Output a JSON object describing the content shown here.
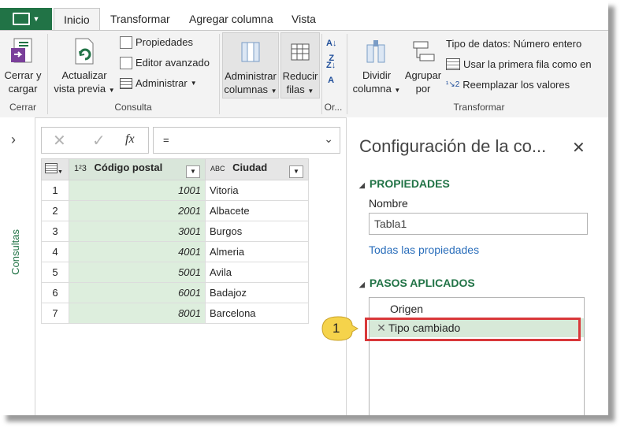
{
  "tabs": {
    "file_label": "",
    "items": [
      "Inicio",
      "Transformar",
      "Agregar columna",
      "Vista"
    ],
    "active": "Inicio"
  },
  "ribbon": {
    "cerrar_y_cargar": [
      "Cerrar y",
      "cargar"
    ],
    "grupo_cerrar": "Cerrar",
    "actualizar": [
      "Actualizar",
      "vista previa"
    ],
    "propiedades": "Propiedades",
    "editor_avanzado": "Editor avanzado",
    "administrar": "Administrar",
    "grupo_consulta": "Consulta",
    "administrar_columnas": [
      "Administrar",
      "columnas"
    ],
    "reducir_filas": [
      "Reducir",
      "filas"
    ],
    "grupo_or": "Or...",
    "dividir_columna": [
      "Dividir",
      "columna"
    ],
    "agrupar_por": [
      "Agrupar",
      "por"
    ],
    "tipo_datos": "Tipo de datos: Número entero",
    "primera_fila": "Usar la primera fila como en",
    "reemplazar": "Reemplazar los valores",
    "grupo_transformar": "Transformar"
  },
  "left_pane": {
    "label": "Consultas"
  },
  "formula_bar": {
    "cancel": "✕",
    "confirm": "✓",
    "fx": "fx",
    "value": "="
  },
  "table": {
    "headers": [
      "Código postal",
      "Ciudad"
    ],
    "header_types": [
      "1²3",
      "ABC"
    ],
    "rows": [
      {
        "n": "1",
        "cp": "1001",
        "city": "Vitoria"
      },
      {
        "n": "2",
        "cp": "2001",
        "city": "Albacete"
      },
      {
        "n": "3",
        "cp": "3001",
        "city": "Burgos"
      },
      {
        "n": "4",
        "cp": "4001",
        "city": "Almeria"
      },
      {
        "n": "5",
        "cp": "5001",
        "city": "Avila"
      },
      {
        "n": "6",
        "cp": "6001",
        "city": "Badajoz"
      },
      {
        "n": "7",
        "cp": "8001",
        "city": "Barcelona"
      }
    ]
  },
  "settings": {
    "title": "Configuración de la co...",
    "properties_section": "PROPIEDADES",
    "name_label": "Nombre",
    "name_value": "Tabla1",
    "all_props_link": "Todas las propiedades",
    "steps_section": "PASOS APLICADOS",
    "steps": [
      "Origen",
      "Tipo cambiado"
    ]
  },
  "callout": {
    "number": "1"
  },
  "colors": {
    "accent": "#217346",
    "highlight": "#d9383a",
    "callout": "#f5d34b"
  }
}
